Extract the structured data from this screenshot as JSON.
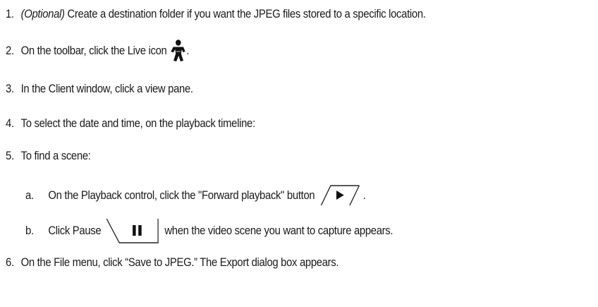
{
  "steps": [
    {
      "num": "1.",
      "italic": "(Optional)",
      "text": " Create a destination folder if you want the JPEG files stored to a specific location."
    },
    {
      "num": "2.",
      "text_before": "On the toolbar, click the Live icon",
      "text_after": "."
    },
    {
      "num": "3.",
      "text": "In the Client window, click a view pane."
    },
    {
      "num": "4.",
      "text": "To select the date and time, on the playback timeline:"
    },
    {
      "num": "5.",
      "text": "To find a scene:"
    },
    {
      "num": "6.",
      "text": "On the File menu, click “Save to JPEG.” The Export dialog box appears."
    }
  ],
  "substeps": [
    {
      "letter": "a.",
      "text_before": "On the Playback control, click the \"Forward playback\" button",
      "text_after": "."
    },
    {
      "letter": "b.",
      "text_before": "Click Pause",
      "text_after": "when the video scene you want to capture appears."
    }
  ],
  "icons": {
    "live": "live-person-icon",
    "forward": "forward-playback-icon",
    "pause": "pause-icon"
  }
}
